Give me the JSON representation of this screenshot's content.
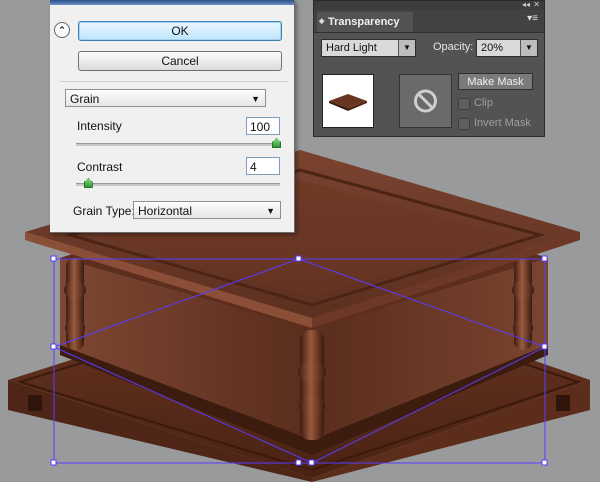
{
  "dialog": {
    "ok_label": "OK",
    "cancel_label": "Cancel",
    "grain_select": "Grain",
    "intensity_label": "Intensity",
    "intensity_value": "100",
    "intensity_fraction": 1.0,
    "contrast_label": "Contrast",
    "contrast_value": "4",
    "contrast_fraction": 0.04,
    "grain_type_label": "Grain Type:",
    "grain_type_value": "Horizontal",
    "collapse_glyph": "⌃"
  },
  "panel": {
    "title": "Transparency",
    "blend_mode": "Hard Light",
    "opacity_label": "Opacity:",
    "opacity_value": "20%",
    "make_mask_label": "Make Mask",
    "clip_label": "Clip",
    "invert_mask_label": "Invert Mask",
    "clip_checked": false,
    "invert_checked": false
  },
  "colors": {
    "canvas": "#999a9c",
    "wood_dark": "#4a2416",
    "wood_mid": "#6e3a26",
    "wood_light": "#8a5038",
    "selection": "#5a3cff"
  },
  "icons": {
    "collapse": "double-chevron-up-icon",
    "menu": "panel-menu-icon",
    "no_mask": "no-symbol-icon"
  }
}
